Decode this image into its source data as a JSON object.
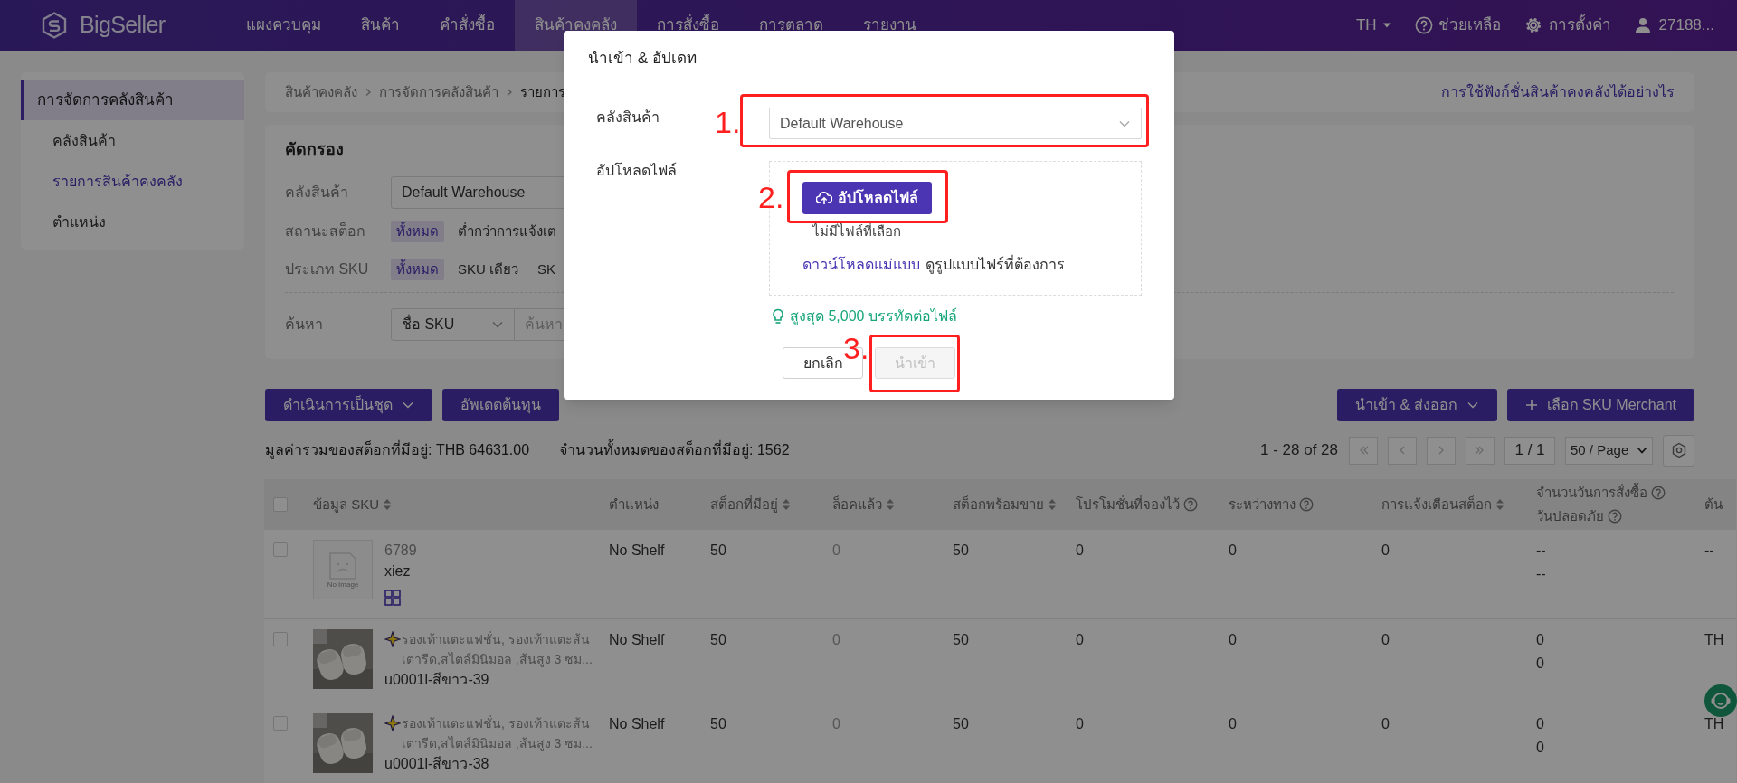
{
  "nav": {
    "logo": "BigSeller",
    "items": [
      {
        "label": "แผงควบคุม",
        "selected": false
      },
      {
        "label": "สินค้า",
        "selected": false
      },
      {
        "label": "คำสั่งซื้อ",
        "selected": false
      },
      {
        "label": "สินค้าคงคลัง",
        "selected": true
      },
      {
        "label": "การสั่งซื้อ",
        "selected": false
      },
      {
        "label": "การตลาด",
        "selected": false
      },
      {
        "label": "รายงาน",
        "selected": false
      }
    ],
    "language": "TH",
    "help": "ช่วยเหลือ",
    "settings": "การตั้งค่า",
    "user": "27188..."
  },
  "sidebar": {
    "group": "การจัดการคลังสินค้า",
    "items": [
      {
        "label": "คลังสินค้า",
        "selected": false
      },
      {
        "label": "รายการสินค้าคงคลัง",
        "selected": true
      },
      {
        "label": "ตำแหน่ง",
        "selected": false
      }
    ]
  },
  "breadcrumb": [
    "สินค้าคงคลัง",
    "การจัดการคลังสินค้า",
    "รายการ"
  ],
  "help_link": "การใช้ฟังก์ชั่นสินค้าคงคลังได้อย่างไร",
  "filter": {
    "title": "คัดกรอง",
    "rows": [
      {
        "kind": "select",
        "label": "คลังสินค้า",
        "value": "Default Warehouse"
      },
      {
        "kind": "options",
        "label": "สถานะสต็อก",
        "options": [
          {
            "label": "ทั้งหมด",
            "selected": true
          },
          {
            "label": "ต่ำกว่าการแจ้งเต",
            "selected": false
          }
        ]
      },
      {
        "kind": "options",
        "label": "ประเภท SKU",
        "options": [
          {
            "label": "ทั้งหมด",
            "selected": true
          },
          {
            "label": "SKU เดียว",
            "selected": false
          },
          {
            "label": "SK",
            "selected": false
          }
        ]
      },
      {
        "kind": "search",
        "label": "ค้นหา",
        "field": "ชื่อ SKU",
        "placeholder": "ค้นหา"
      }
    ]
  },
  "actions_left": [
    {
      "label": "ดำเนินการเป็นชุด",
      "kind": "dropdown"
    },
    {
      "label": "อัพเดตต้นทุน",
      "kind": "plain"
    }
  ],
  "actions_right": [
    {
      "label": "นำเข้า & ส่งออก",
      "kind": "dropdown"
    },
    {
      "label": "เลือก SKU Merchant",
      "kind": "add"
    }
  ],
  "summary": [
    "มูลค่ารวมของสต็อกที่มีอยู่: THB 64631.00",
    "จำนวนทั้งหมดของสต็อกที่มีอยู่: 1562"
  ],
  "pagination": {
    "range": "1 - 28 of 28",
    "page": "1 / 1",
    "page_size": "50 / Page"
  },
  "table": {
    "select_all": {
      "checked": false
    },
    "sku_column": {
      "label": "ข้อมูล SKU",
      "sortable": true
    },
    "columns": [
      {
        "label": "ตำแหน่ง",
        "sortable": false,
        "help": false
      },
      {
        "label": "สต็อกที่มีอยู่",
        "sortable": true,
        "help": false
      },
      {
        "label": "ล็อคแล้ว",
        "sortable": true,
        "help": false,
        "muted": true
      },
      {
        "label": "สต็อกพร้อมขาย",
        "sortable": true,
        "help": false
      },
      {
        "label": "โปรโมชั่นที่จองไว้",
        "sortable": false,
        "help": true
      },
      {
        "label": "ระหว่างทาง",
        "sortable": false,
        "help": true
      },
      {
        "label": "การแจ้งเตือนสต็อก",
        "sortable": true,
        "help": false
      },
      {
        "label": "จำนวนวันการสั่งซื้อ",
        "sortable": false,
        "help": true,
        "sublabel": "วันปลอดภัย",
        "sub_help": true
      },
      {
        "label": "ต้น",
        "sortable": false,
        "help": false
      }
    ],
    "rows": [
      {
        "checked": false,
        "image": {
          "kind": "placeholder",
          "label": "No Image"
        },
        "sparkle": false,
        "title": "6789",
        "sku": "xiez",
        "combo": true,
        "cells": [
          "No Shelf",
          "50",
          "0",
          "50",
          "0",
          "0",
          "0",
          [
            "--",
            "--"
          ],
          "--"
        ]
      },
      {
        "checked": false,
        "image": {
          "kind": "picture"
        },
        "sparkle": true,
        "title": "รองเท้าแตะแฟชั่น, รองเท้าแตะส้นเตารีด,สไตล์มินิมอล ,ส้นสูง 3 ซม...",
        "sku": "u0001l-สีขาว-39",
        "combo": false,
        "cells": [
          "No Shelf",
          "50",
          "0",
          "50",
          "0",
          "0",
          "0",
          [
            "0",
            "0"
          ],
          "TH"
        ]
      },
      {
        "checked": false,
        "image": {
          "kind": "picture"
        },
        "sparkle": true,
        "title": "รองเท้าแตะแฟชั่น, รองเท้าแตะส้นเตารีด,สไตล์มินิมอล ,ส้นสูง 3 ซม...",
        "sku": "u0001l-สีขาว-38",
        "combo": false,
        "cells": [
          "No Shelf",
          "50",
          "0",
          "50",
          "0",
          "0",
          "0",
          [
            "0",
            "0"
          ],
          "TH"
        ]
      }
    ]
  },
  "modal": {
    "title": "นำเข้า & อัปเดท",
    "fields": [
      {
        "kind": "select",
        "label": "คลังสินค้า",
        "value": "Default Warehouse",
        "annotation": "1."
      },
      {
        "kind": "upload",
        "label": "อัปโหลดไฟล์",
        "button": "อัปโหลดไฟล์",
        "status": "ไม่มีไฟล์ที่เลือก",
        "link": "ดาวน์โหลดแม่แบบ",
        "note": "ดูรูปแบบไฟร์ที่ต้องการ",
        "annotation": "2."
      }
    ],
    "hint": "สูงสุด 5,000 บรรทัดต่อไฟล์",
    "buttons": [
      {
        "label": "ยกเลิก",
        "disabled": false
      },
      {
        "label": "นำเข้า",
        "disabled": true,
        "annotation": "3."
      }
    ]
  }
}
